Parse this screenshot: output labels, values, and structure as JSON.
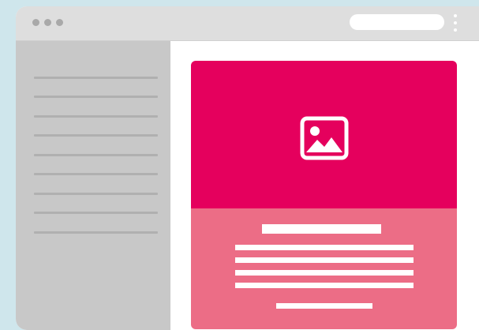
{
  "browser": {
    "window_dots": 3,
    "address_bar_text": "",
    "menu_icon": "kebab-menu-icon"
  },
  "sidebar": {
    "item_count": 9
  },
  "card": {
    "media_icon": "image-icon",
    "heading_placeholder": "",
    "text_line_placeholders": 4,
    "footer_placeholder": ""
  },
  "colors": {
    "background": "#cfe6ec",
    "titlebar": "#dedede",
    "sidebar": "#c8c8c8",
    "sidebar_lines": "#b0b0b0",
    "media_accent": "#e5005d",
    "card_body": "#ec6d86",
    "placeholder": "#ffffff"
  }
}
